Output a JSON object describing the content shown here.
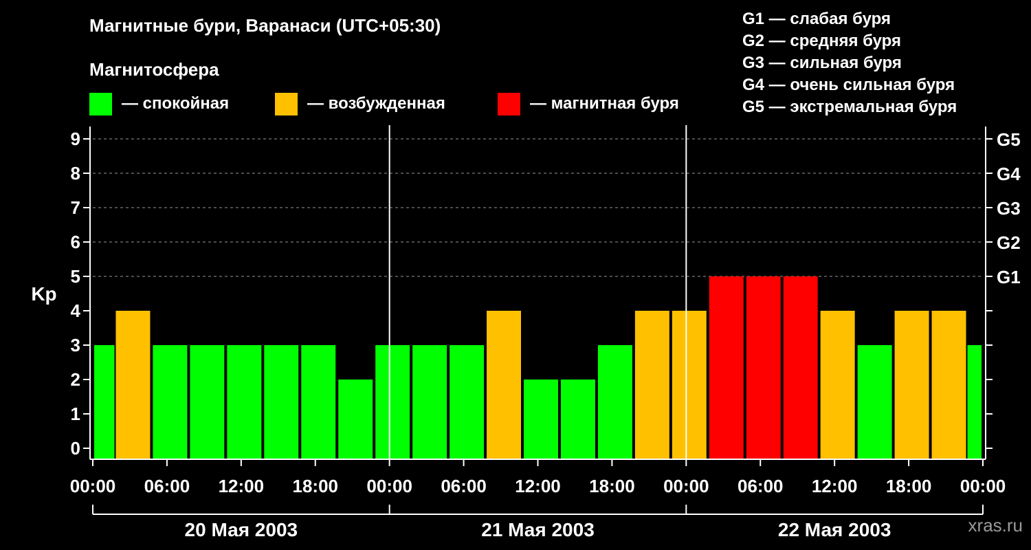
{
  "title": "Магнитные бури, Варанаси (UTC+05:30)",
  "magnetosphere_label": "Магнитосфера",
  "legend": [
    {
      "label": "— спокойная",
      "color": "#00ff00"
    },
    {
      "label": "— возбужденная",
      "color": "#ffc000"
    },
    {
      "label": "— магнитная буря",
      "color": "#ff0000"
    }
  ],
  "storm_levels": [
    "G1 — слабая буря",
    "G2 — средняя буря",
    "G3 — сильная буря",
    "G4 — очень сильная буря",
    "G5 — экстремальная буря"
  ],
  "watermark": "xras.ru",
  "chart_data": {
    "type": "bar",
    "ylabel": "Kp",
    "ylim": [
      0,
      9
    ],
    "yticks": [
      "0",
      "1",
      "2",
      "3",
      "4",
      "5",
      "6",
      "7",
      "8",
      "9"
    ],
    "right_ticks": [
      {
        "kp": 5,
        "label": "G1"
      },
      {
        "kp": 6,
        "label": "G2"
      },
      {
        "kp": 7,
        "label": "G3"
      },
      {
        "kp": 8,
        "label": "G4"
      },
      {
        "kp": 9,
        "label": "G5"
      }
    ],
    "grid": "dashed horizontal lines at Kp 5–9",
    "xlim_hours": [
      0,
      72
    ],
    "xticks": [
      "00:00",
      "06:00",
      "12:00",
      "18:00",
      "00:00",
      "06:00",
      "12:00",
      "18:00",
      "00:00",
      "06:00",
      "12:00",
      "18:00",
      "00:00"
    ],
    "days": [
      "20 Мая 2003",
      "21 Мая 2003",
      "22 Мая 2003"
    ],
    "bars": [
      {
        "start": 0,
        "end": 1.75,
        "kp": 3
      },
      {
        "start": 1.75,
        "end": 4.75,
        "kp": 4
      },
      {
        "start": 4.75,
        "end": 7.75,
        "kp": 3
      },
      {
        "start": 7.75,
        "end": 10.75,
        "kp": 3
      },
      {
        "start": 10.75,
        "end": 13.75,
        "kp": 3
      },
      {
        "start": 13.75,
        "end": 16.75,
        "kp": 3
      },
      {
        "start": 16.75,
        "end": 19.75,
        "kp": 3
      },
      {
        "start": 19.75,
        "end": 22.75,
        "kp": 2
      },
      {
        "start": 22.75,
        "end": 25.75,
        "kp": 3
      },
      {
        "start": 25.75,
        "end": 28.75,
        "kp": 3
      },
      {
        "start": 28.75,
        "end": 31.75,
        "kp": 3
      },
      {
        "start": 31.75,
        "end": 34.75,
        "kp": 4
      },
      {
        "start": 34.75,
        "end": 37.75,
        "kp": 2
      },
      {
        "start": 37.75,
        "end": 40.75,
        "kp": 2
      },
      {
        "start": 40.75,
        "end": 43.75,
        "kp": 3
      },
      {
        "start": 43.75,
        "end": 46.75,
        "kp": 4
      },
      {
        "start": 46.75,
        "end": 49.75,
        "kp": 4
      },
      {
        "start": 49.75,
        "end": 52.75,
        "kp": 5
      },
      {
        "start": 52.75,
        "end": 55.75,
        "kp": 5
      },
      {
        "start": 55.75,
        "end": 58.75,
        "kp": 5
      },
      {
        "start": 58.75,
        "end": 61.75,
        "kp": 4
      },
      {
        "start": 61.75,
        "end": 64.75,
        "kp": 3
      },
      {
        "start": 64.75,
        "end": 67.75,
        "kp": 4
      },
      {
        "start": 67.75,
        "end": 70.75,
        "kp": 4
      },
      {
        "start": 70.75,
        "end": 72,
        "kp": 3
      }
    ]
  }
}
